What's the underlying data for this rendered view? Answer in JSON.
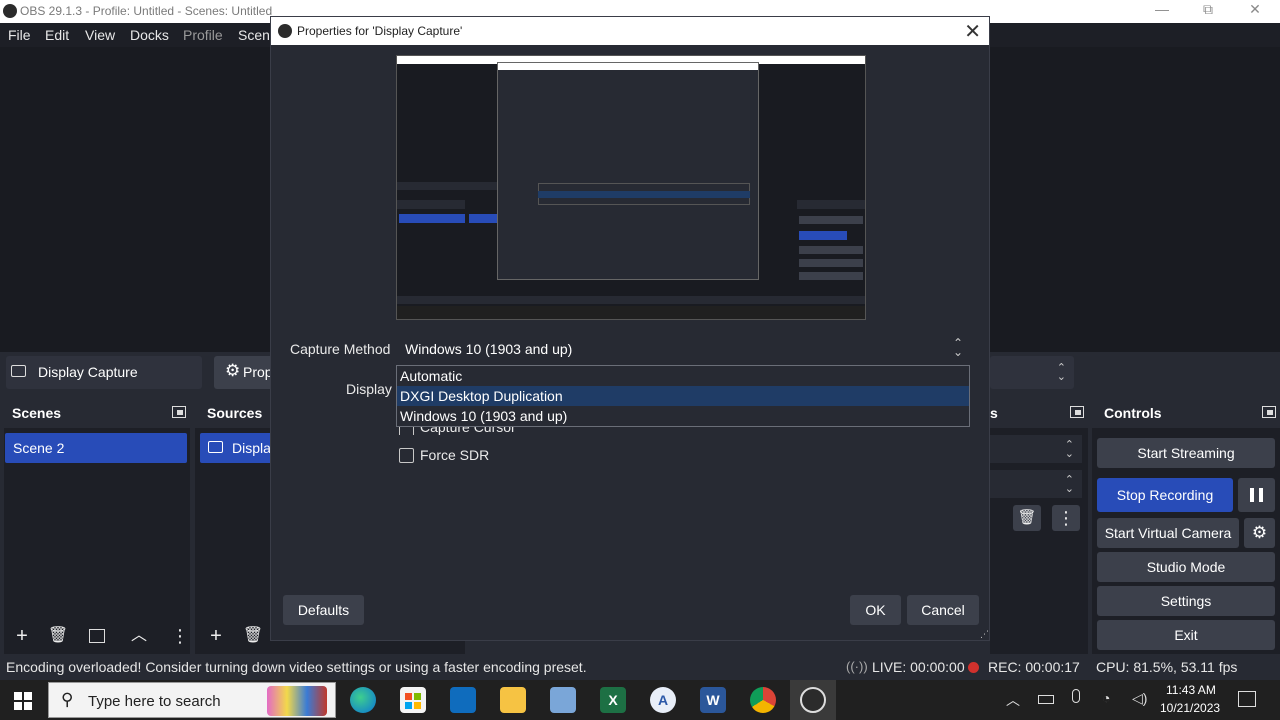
{
  "window": {
    "title": "OBS 29.1.3 - Profile: Untitled - Scenes: Untitled",
    "controls": {
      "minimize": "—",
      "restore": "⧉",
      "close": "✕"
    }
  },
  "menu": [
    "File",
    "Edit",
    "View",
    "Docks",
    "Profile",
    "Scene"
  ],
  "source_toolbar": {
    "source_name": "Display Capture",
    "properties_label": "Prop"
  },
  "docks": {
    "scenes": {
      "title": "Scenes",
      "items": [
        "Scene 2"
      ]
    },
    "sources": {
      "title": "Sources",
      "items": [
        "Displa"
      ]
    },
    "mixer": {
      "title": "s"
    },
    "controls": {
      "title": "Controls",
      "buttons": [
        "Start Streaming",
        "Stop Recording",
        "Start Virtual Camera",
        "Studio Mode",
        "Settings",
        "Exit"
      ]
    }
  },
  "status": {
    "message": "Encoding overloaded! Consider turning down video settings or using a faster encoding preset.",
    "live": "LIVE: 00:00:00",
    "rec": "REC: 00:00:17",
    "cpu": "CPU: 81.5%, 53.11 fps"
  },
  "taskbar": {
    "search_placeholder": "Type here to search",
    "time": "11:43 AM",
    "date": "10/21/2023"
  },
  "dialog": {
    "title": "Properties for 'Display Capture'",
    "capture_method_label": "Capture Method",
    "capture_method_value": "Windows 10 (1903 and up)",
    "display_label": "Display",
    "dropdown_options": [
      "Automatic",
      "DXGI Desktop Duplication",
      "Windows 10 (1903 and up)"
    ],
    "selected_option_index": 1,
    "capture_cursor_label": "Capture Cursor",
    "force_sdr_label": "Force SDR",
    "defaults_label": "Defaults",
    "ok_label": "OK",
    "cancel_label": "Cancel"
  },
  "colors": {
    "accent_blue": "#284cb8",
    "background": "#272a33",
    "dock_body": "#1d1f26",
    "button": "#3c404b",
    "rec_dot": "#d0312d"
  }
}
